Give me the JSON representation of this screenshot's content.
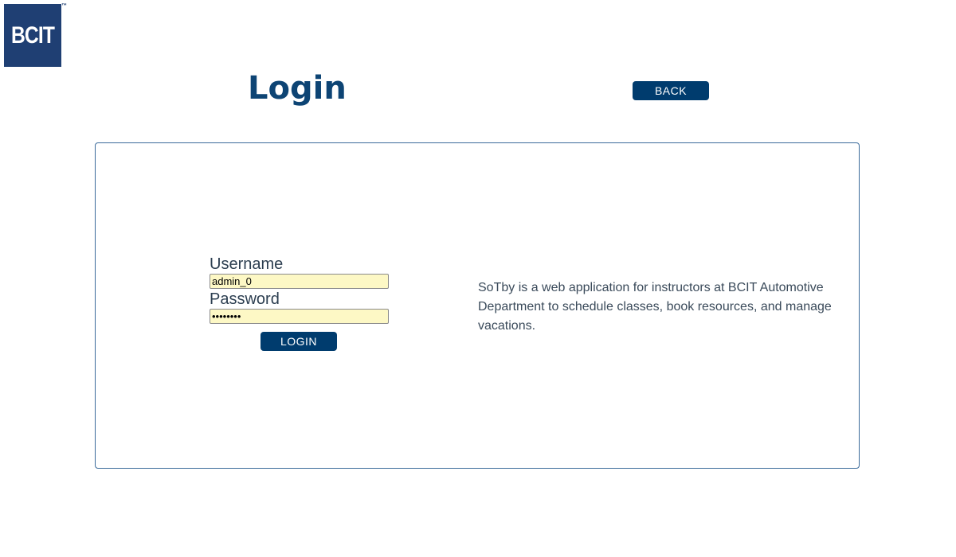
{
  "brand": {
    "logo_text": "BCIT",
    "trademark": "™",
    "logo_color": "#1f3f73"
  },
  "header": {
    "title": "Login",
    "back_label": "BACK"
  },
  "form": {
    "username_label": "Username",
    "username_value": "admin_0",
    "password_label": "Password",
    "password_value": "password",
    "login_label": "LOGIN"
  },
  "info": {
    "description": "SoTby is a web application for instructors at BCIT Automotive Department to schedule classes, book resources, and manage vacations."
  },
  "colors": {
    "accent": "#003c6e",
    "title": "#0d4474",
    "input_background": "#fdf8c5",
    "card_border": "#3a6a9a"
  }
}
